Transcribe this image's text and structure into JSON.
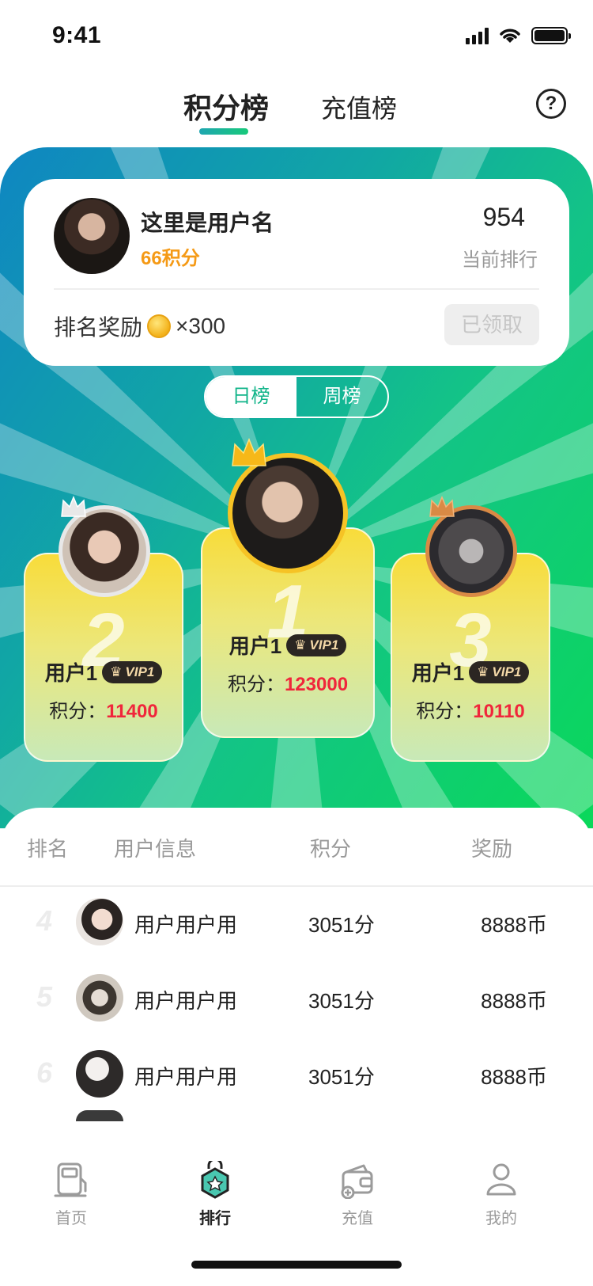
{
  "status_bar": {
    "time": "9:41"
  },
  "header": {
    "tabs": [
      {
        "label": "积分榜",
        "active": true
      },
      {
        "label": "充值榜",
        "active": false
      }
    ],
    "help_symbol": "?"
  },
  "my_card": {
    "username": "这里是用户名",
    "points": "66积分",
    "rank_value": "954",
    "rank_label": "当前排行",
    "reward_label": "排名奖励",
    "reward_icon": "coin-icon",
    "reward_amount": "×300",
    "claim_button": "已领取"
  },
  "period_toggle": {
    "options": [
      {
        "label": "日榜",
        "active": true
      },
      {
        "label": "周榜",
        "active": false
      }
    ]
  },
  "podium": [
    {
      "rank": "1",
      "name": "用户1",
      "vip": "VIP1",
      "score_label": "积分：",
      "score": "123000",
      "crown_color": "#f6b819"
    },
    {
      "rank": "2",
      "name": "用户1",
      "vip": "VIP1",
      "score_label": "积分：",
      "score": "11400",
      "crown_color": "#e5e5e5"
    },
    {
      "rank": "3",
      "name": "用户1",
      "vip": "VIP1",
      "score_label": "积分：",
      "score": "10110",
      "crown_color": "#d98a45"
    }
  ],
  "table": {
    "headers": [
      "排名",
      "用户信息",
      "积分",
      "奖励"
    ],
    "rows": [
      {
        "rank": "4",
        "name": "用户用户用",
        "points": "3051分",
        "reward": "8888币"
      },
      {
        "rank": "5",
        "name": "用户用户用",
        "points": "3051分",
        "reward": "8888币"
      },
      {
        "rank": "6",
        "name": "用户用户用",
        "points": "3051分",
        "reward": "8888币"
      }
    ]
  },
  "tab_bar": {
    "items": [
      {
        "label": "首页",
        "icon": "home-icon",
        "active": false
      },
      {
        "label": "排行",
        "icon": "ranking-icon",
        "active": true
      },
      {
        "label": "充值",
        "icon": "recharge-icon",
        "active": false
      },
      {
        "label": "我的",
        "icon": "profile-icon",
        "active": false
      }
    ]
  },
  "colors": {
    "accent_green": "#11b489",
    "score_red": "#f0263b",
    "points_orange": "#f59a16"
  }
}
